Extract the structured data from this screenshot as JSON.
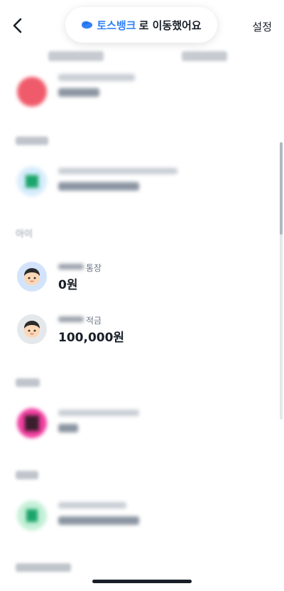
{
  "header": {
    "back_icon": "chevron-left-icon",
    "brand": "토스뱅크",
    "suffix": "로 이동했어요",
    "settings": "설정"
  },
  "section_kids": {
    "label": "아이"
  },
  "accounts": [
    {
      "name": "통장",
      "amount": "0원"
    },
    {
      "name": "적금",
      "amount": "100,000원"
    }
  ],
  "colors": {
    "brand": "#3182f6",
    "text": "#191f28",
    "subtext": "#6b7684"
  }
}
